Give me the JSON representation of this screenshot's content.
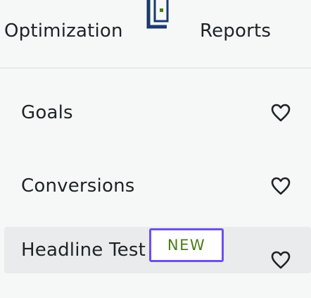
{
  "header": {
    "left_tab": "Optimization",
    "right_tab": "Reports",
    "handle_icon": "drag-handle-icon"
  },
  "menu": {
    "items": [
      {
        "label": "Goals",
        "icon": "heart-icon"
      },
      {
        "label": "Conversions",
        "icon": "heart-icon"
      },
      {
        "label": "Headline Test",
        "badge": "NEW",
        "icon": "heart-icon"
      }
    ]
  },
  "colors": {
    "background": "#f6f7f7",
    "active_row": "#eaebec",
    "text": "#1d2327",
    "badge_border": "#6d4ff2",
    "badge_text": "#4a7d16",
    "handle": "#1a3a6b",
    "handle_dot": "#4a7d16"
  }
}
